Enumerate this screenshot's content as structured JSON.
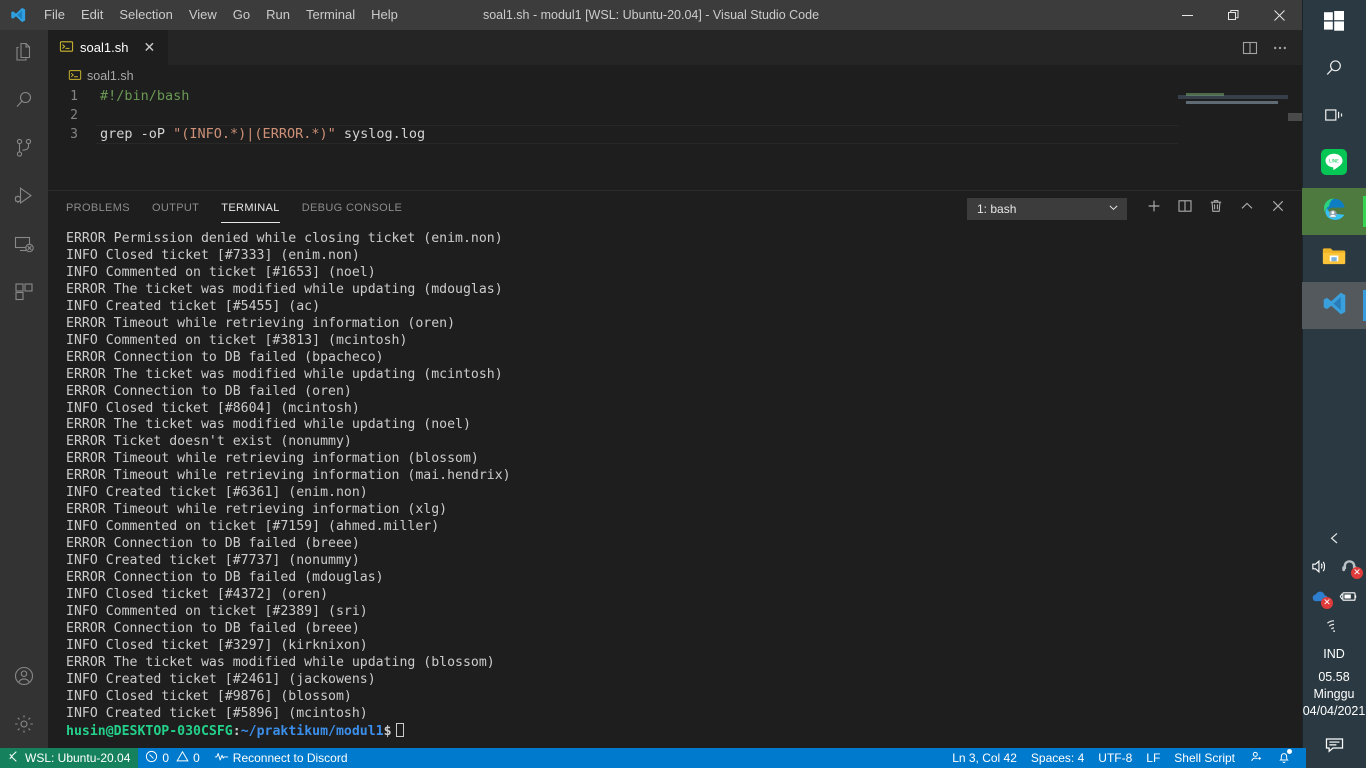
{
  "window": {
    "title": "soal1.sh - modul1 [WSL: Ubuntu-20.04] - Visual Studio Code",
    "logo_icon": "vscode-logo-icon",
    "minimize_icon": "minimize-icon",
    "maximize_icon": "restore-icon",
    "close_icon": "close-icon"
  },
  "menubar": {
    "items": [
      {
        "label": "File"
      },
      {
        "label": "Edit"
      },
      {
        "label": "Selection"
      },
      {
        "label": "View"
      },
      {
        "label": "Go"
      },
      {
        "label": "Run"
      },
      {
        "label": "Terminal"
      },
      {
        "label": "Help"
      }
    ]
  },
  "activitybar": {
    "items": [
      {
        "name": "explorer",
        "icon": "files-icon"
      },
      {
        "name": "search",
        "icon": "search-icon"
      },
      {
        "name": "source-control",
        "icon": "source-control-icon"
      },
      {
        "name": "run-and-debug",
        "icon": "run-debug-icon"
      },
      {
        "name": "remote-explorer",
        "icon": "remote-explorer-icon"
      },
      {
        "name": "extensions",
        "icon": "extensions-icon"
      }
    ],
    "bottom": [
      {
        "name": "accounts",
        "icon": "account-icon"
      },
      {
        "name": "manage",
        "icon": "gear-icon"
      }
    ]
  },
  "editor": {
    "tab": {
      "label": "soal1.sh",
      "file_icon": "shell-file-icon",
      "close_icon": "close-icon"
    },
    "tab_actions": [
      {
        "name": "split-editor",
        "icon": "split-editor-icon"
      },
      {
        "name": "more-actions",
        "icon": "ellipsis-icon"
      }
    ],
    "breadcrumb": {
      "file_icon": "shell-file-icon",
      "label": "soal1.sh"
    },
    "lines": [
      {
        "num": "1",
        "tokens": [
          {
            "cls": "c-comment",
            "text": "#!/bin/bash"
          }
        ]
      },
      {
        "num": "2",
        "tokens": [
          {
            "cls": "c-plain",
            "text": ""
          }
        ]
      },
      {
        "num": "3",
        "tokens": [
          {
            "cls": "c-plain",
            "text": "grep -oP "
          },
          {
            "cls": "c-str",
            "text": "\"(INFO.*)|(ERROR.*)\""
          },
          {
            "cls": "c-plain",
            "text": " syslog.log"
          }
        ]
      }
    ]
  },
  "panel": {
    "tabs": [
      {
        "label": "PROBLEMS",
        "active": false
      },
      {
        "label": "OUTPUT",
        "active": false
      },
      {
        "label": "TERMINAL",
        "active": true
      },
      {
        "label": "DEBUG CONSOLE",
        "active": false
      }
    ],
    "terminal_select": {
      "value": "1: bash",
      "chevron_icon": "chevron-down-icon"
    },
    "actions": [
      {
        "name": "new-terminal",
        "icon": "plus-icon"
      },
      {
        "name": "split-terminal",
        "icon": "split-terminal-icon"
      },
      {
        "name": "kill-terminal",
        "icon": "trash-icon"
      },
      {
        "name": "maximize-panel",
        "icon": "chevron-up-icon"
      },
      {
        "name": "close-panel",
        "icon": "close-icon"
      }
    ]
  },
  "terminal": {
    "lines": [
      "ERROR Permission denied while closing ticket (enim.non)",
      "INFO Closed ticket [#7333] (enim.non)",
      "INFO Commented on ticket [#1653] (noel)",
      "ERROR The ticket was modified while updating (mdouglas)",
      "INFO Created ticket [#5455] (ac)",
      "ERROR Timeout while retrieving information (oren)",
      "INFO Commented on ticket [#3813] (mcintosh)",
      "ERROR Connection to DB failed (bpacheco)",
      "ERROR The ticket was modified while updating (mcintosh)",
      "ERROR Connection to DB failed (oren)",
      "INFO Closed ticket [#8604] (mcintosh)",
      "ERROR The ticket was modified while updating (noel)",
      "ERROR Ticket doesn't exist (nonummy)",
      "ERROR Timeout while retrieving information (blossom)",
      "ERROR Timeout while retrieving information (mai.hendrix)",
      "INFO Created ticket [#6361] (enim.non)",
      "ERROR Timeout while retrieving information (xlg)",
      "INFO Commented on ticket [#7159] (ahmed.miller)",
      "ERROR Connection to DB failed (breee)",
      "INFO Created ticket [#7737] (nonummy)",
      "ERROR Connection to DB failed (mdouglas)",
      "INFO Closed ticket [#4372] (oren)",
      "INFO Commented on ticket [#2389] (sri)",
      "ERROR Connection to DB failed (breee)",
      "INFO Closed ticket [#3297] (kirknixon)",
      "ERROR The ticket was modified while updating (blossom)",
      "INFO Created ticket [#2461] (jackowens)",
      "INFO Closed ticket [#9876] (blossom)",
      "INFO Created ticket [#5896] (mcintosh)"
    ],
    "prompt": {
      "user_host": "husin@DESKTOP-030CSFG",
      "separator": ":",
      "path": "~/praktikum/modul1",
      "dollar": "$"
    }
  },
  "statusbar": {
    "remote": {
      "label": "WSL: Ubuntu-20.04",
      "icon": "remote-icon"
    },
    "errors": {
      "icon": "error-icon",
      "count": "0"
    },
    "warnings": {
      "icon": "warning-icon",
      "count": "0"
    },
    "discord": {
      "icon": "discord-activity-icon",
      "label": "Reconnect to Discord"
    },
    "right": [
      {
        "name": "editor-position",
        "label": "Ln 3, Col 42"
      },
      {
        "name": "indentation",
        "label": "Spaces: 4"
      },
      {
        "name": "encoding",
        "label": "UTF-8"
      },
      {
        "name": "eol",
        "label": "LF"
      },
      {
        "name": "language-mode",
        "label": "Shell Script"
      }
    ],
    "feedback_icon": "tweet-feedback-icon",
    "bell_icon": "bell-dot-icon"
  },
  "taskbar": {
    "items": [
      {
        "name": "start",
        "icon": "windows-start-icon",
        "state": "idle"
      },
      {
        "name": "search",
        "icon": "search-icon",
        "state": "idle"
      },
      {
        "name": "task-view",
        "icon": "task-view-icon",
        "state": "idle"
      },
      {
        "name": "line",
        "icon": "line-app-icon",
        "state": "idle"
      },
      {
        "name": "microsoft-edge",
        "icon": "edge-icon",
        "state": "running"
      },
      {
        "name": "file-explorer",
        "icon": "folder-icon",
        "state": "idle"
      },
      {
        "name": "visual-studio-code",
        "icon": "vscode-icon",
        "state": "running"
      }
    ],
    "tray": {
      "chevron_icon": "chevron-up-icon",
      "volume_icon": "speaker-icon",
      "headset_icon": "headset-muted-icon",
      "onedrive_icon": "onedrive-error-icon",
      "battery_icon": "battery-charging-icon",
      "wifi_icon": "wifi-icon",
      "language": "IND",
      "time": "05.58",
      "day": "Minggu",
      "date": "04/04/2021",
      "action_center_icon": "action-center-icon"
    }
  },
  "colors": {
    "accent": "#007acc",
    "remote_green": "#16825d",
    "editor_bg": "#1e1e1e",
    "panel_bg": "#1e1e1e",
    "titlebar_bg": "#3c3c3c",
    "activitybar_bg": "#333333",
    "terminal_text": "#cccccc",
    "prompt_green": "#23d18b",
    "prompt_blue": "#2472c8",
    "comment_green": "#6a9955",
    "string_orange": "#ce9178"
  }
}
